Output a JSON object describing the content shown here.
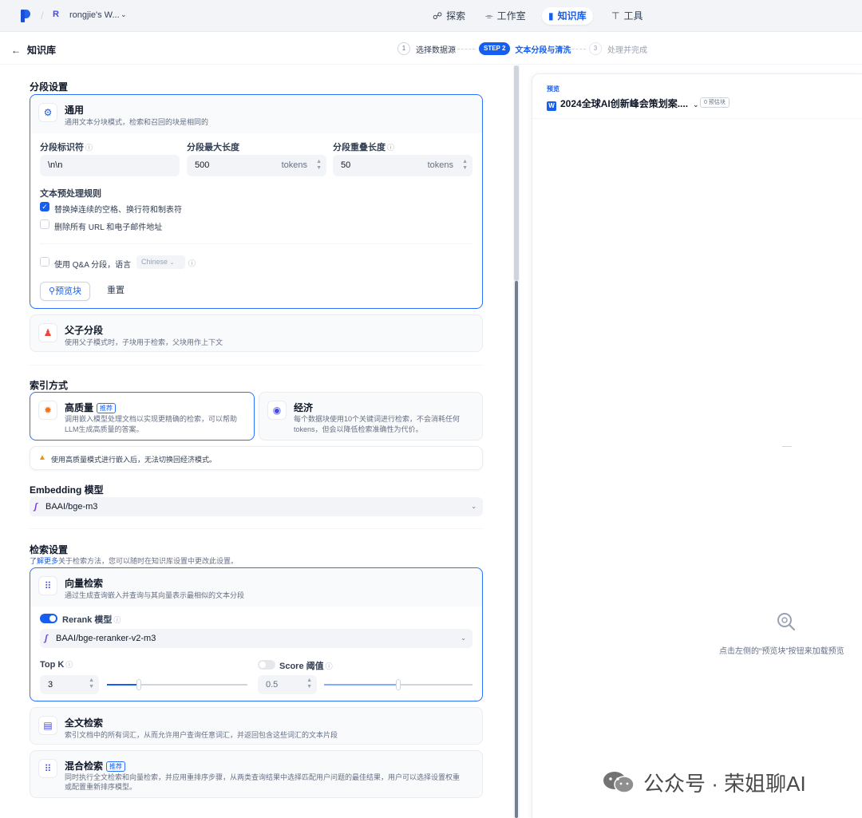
{
  "nav": {
    "workspace_initial": "R",
    "workspace_name": "rongjie's W...",
    "items": [
      {
        "label": "探索",
        "icon": "compass-icon"
      },
      {
        "label": "工作室",
        "icon": "robot-icon"
      },
      {
        "label": "知识库",
        "icon": "book-icon",
        "active": true
      },
      {
        "label": "工具",
        "icon": "hammer-icon"
      }
    ]
  },
  "stepper": {
    "back_label": "知识库",
    "steps": [
      {
        "num": "1",
        "label": "选择数据源"
      },
      {
        "num": "STEP 2",
        "label": "文本分段与清洗"
      },
      {
        "num": "3",
        "label": "处理并完成"
      }
    ]
  },
  "segmentation": {
    "title": "分段设置",
    "general": {
      "title": "通用",
      "desc": "通用文本分块模式，检索和召回的块是相同的",
      "separator_label": "分段标识符",
      "separator_value": "\\n\\n",
      "max_len_label": "分段最大长度",
      "max_len_value": "500",
      "overlap_label": "分段重叠长度",
      "overlap_value": "50",
      "unit": "tokens",
      "rules_label": "文本预处理规则",
      "rule1": "替换掉连续的空格、换行符和制表符",
      "rule1_checked": true,
      "rule2": "删除所有 URL 和电子邮件地址",
      "rule2_checked": false,
      "qa_label": "使用 Q&A 分段，语言",
      "qa_lang": "Chinese",
      "preview_button": "预览块",
      "reset_button": "重置"
    },
    "parent_child": {
      "title": "父子分段",
      "desc": "使用父子模式时，子块用于检索，父块用作上下文"
    }
  },
  "index": {
    "title": "索引方式",
    "high_quality": {
      "title": "高质量",
      "badge": "推荐",
      "desc_line1": "调用嵌入模型处理文档以实现更精确的检索，可以帮助",
      "desc_line2": "LLM生成高质量的答案。"
    },
    "economy": {
      "title": "经济",
      "desc_line1": "每个数据块使用10个关键词进行检索，不会消耗任何",
      "desc_line2": "tokens，但会以降低检索准确性为代价。"
    },
    "warning": "使用高质量模式进行嵌入后，无法切换回经济模式。"
  },
  "embedding": {
    "title": "Embedding 模型",
    "model": "BAAI/bge-m3"
  },
  "retrieval": {
    "title": "检索设置",
    "learn_more": "了解更多",
    "subtitle": "关于检索方法，您可以随时在知识库设置中更改此设置。",
    "vector": {
      "title": "向量检索",
      "desc": "通过生成查询嵌入并查询与其向量表示最相似的文本分段",
      "rerank_label": "Rerank 模型",
      "rerank_on": true,
      "rerank_model": "BAAI/bge-reranker-v2-m3",
      "topk_label": "Top K",
      "topk_value": "3",
      "topk_fraction": 0.23,
      "score_label": "Score 阈值",
      "score_on": false,
      "score_value": "0.5",
      "score_fraction": 0.5
    },
    "fulltext": {
      "title": "全文检索",
      "desc": "索引文档中的所有词汇，从而允许用户查询任意词汇，并返回包含这些词汇的文本片段"
    },
    "hybrid": {
      "title": "混合检索",
      "badge": "推荐",
      "desc_line1": "同时执行全文检索和向量检索，并应用重排序步骤，从两类查询结果中选择匹配用户问题的最佳结果，用户可以选择设置权重",
      "desc_line2": "或配置重新排序模型。"
    }
  },
  "preview": {
    "label": "预览",
    "doc_name": "2024全球AI创新峰会策划案....",
    "count": "0 预估块",
    "empty_text": "点击左侧的“预览块”按钮来加载预览"
  },
  "watermark": "公众号 · 荣姐聊AI",
  "colors": {
    "accent": "#155eef",
    "warning": "#f79009",
    "model_icon": "#7839ee"
  }
}
